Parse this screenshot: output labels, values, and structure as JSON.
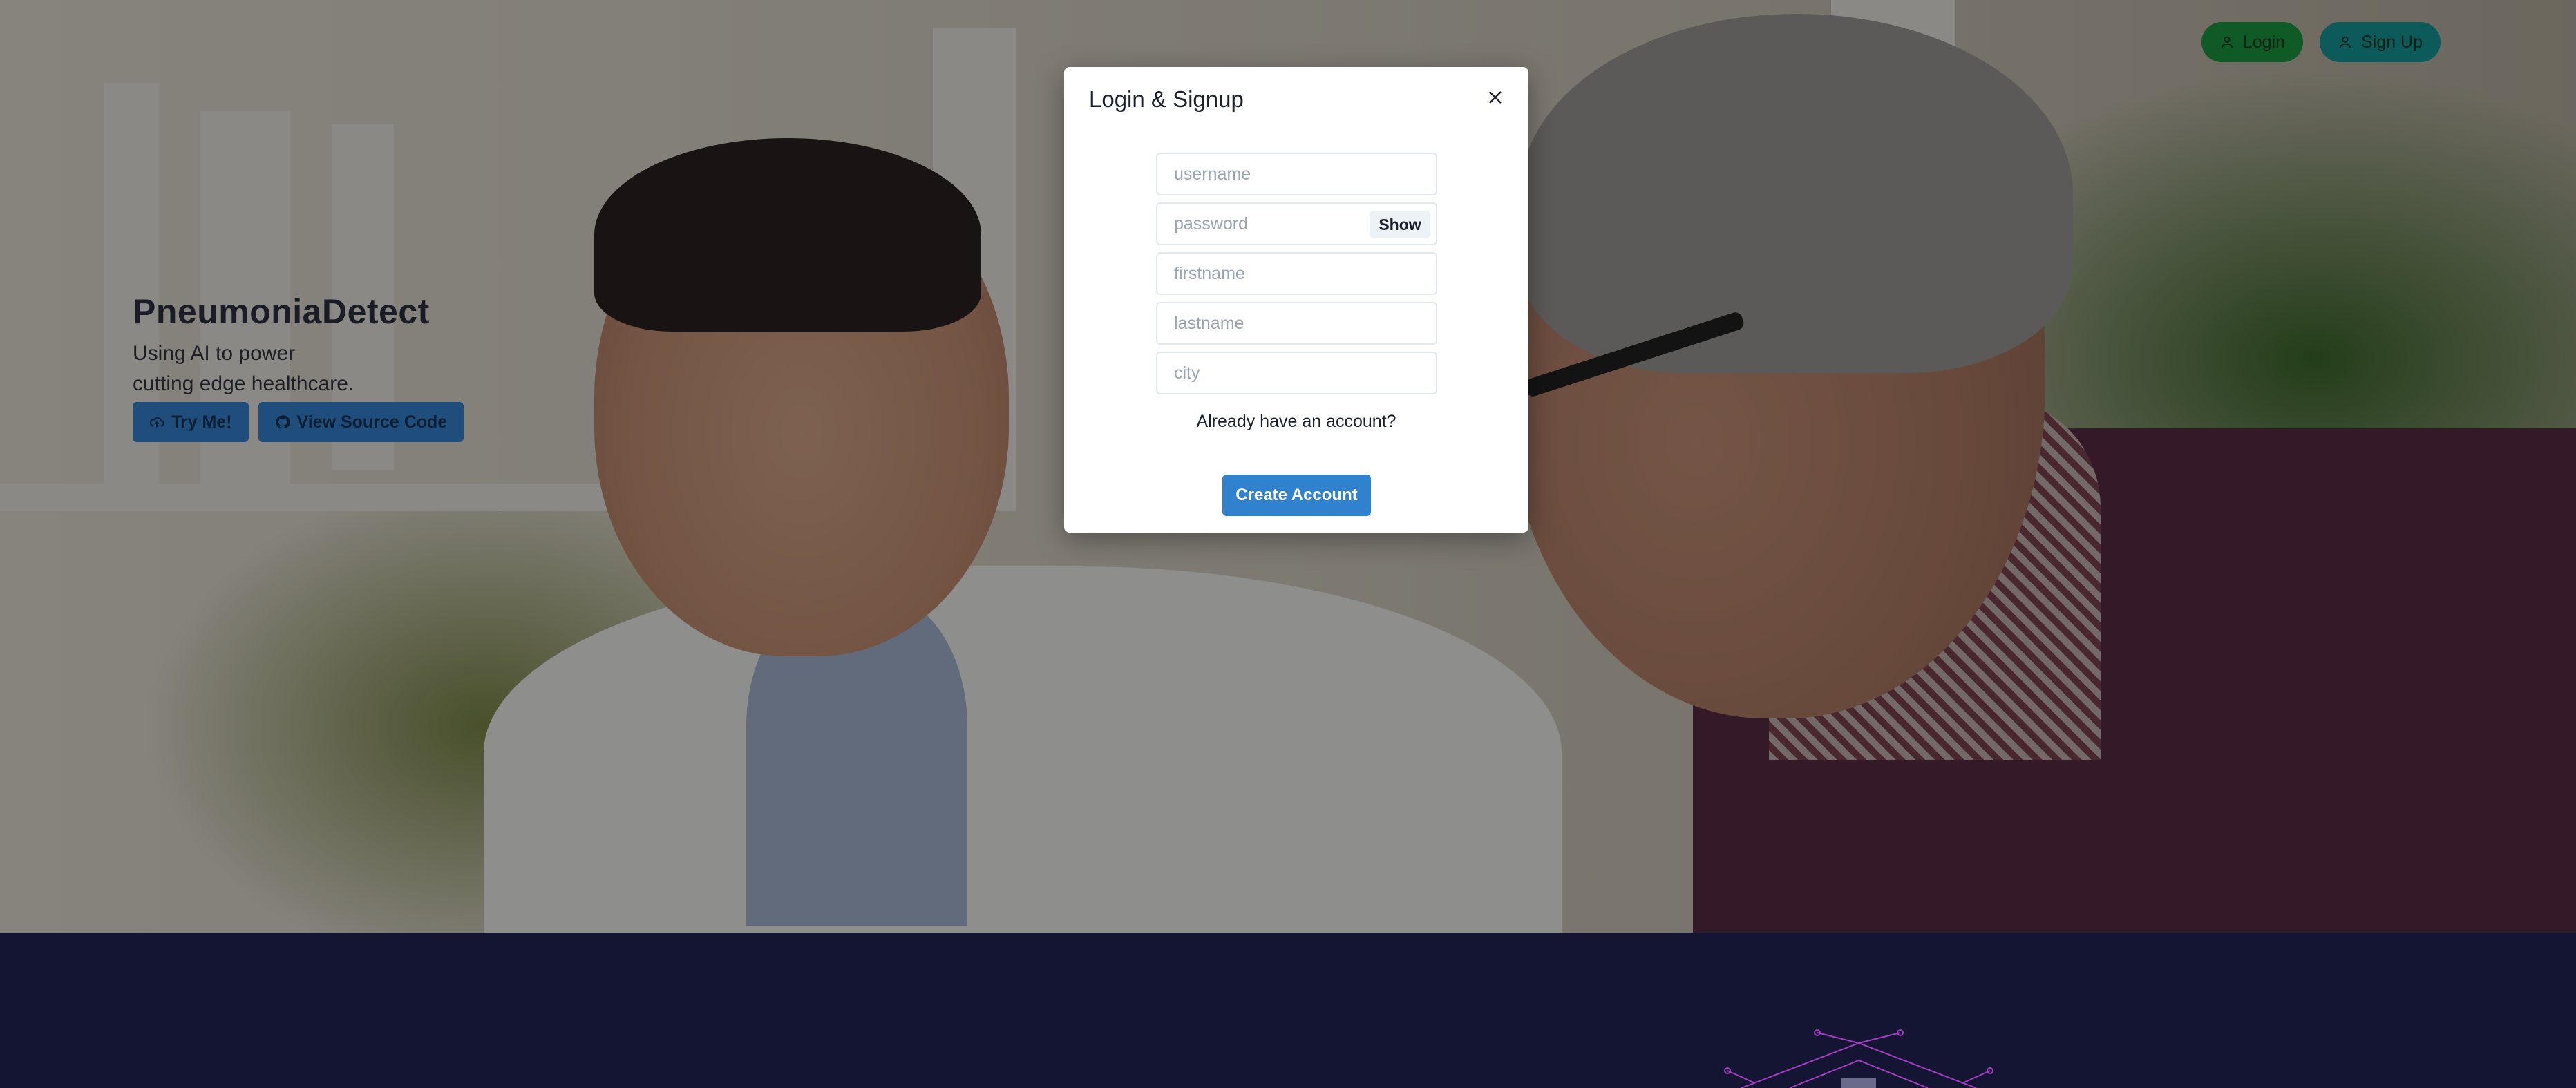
{
  "nav": {
    "login_label": "Login",
    "signup_label": "Sign Up"
  },
  "hero": {
    "title": "PneumoniaDetect",
    "subtitle_line1": "Using AI to power",
    "subtitle_line2": "cutting edge healthcare.",
    "try_label": "Try Me!",
    "source_label": "View Source Code"
  },
  "modal": {
    "title": "Login & Signup",
    "username_placeholder": "username",
    "password_placeholder": "password",
    "show_label": "Show",
    "firstname_placeholder": "firstname",
    "lastname_placeholder": "lastname",
    "city_placeholder": "city",
    "switch_text": "Already have an account?",
    "create_label": "Create Account"
  },
  "colors": {
    "primary_button": "#3182ce",
    "hero_button": "#1f4e7d",
    "login_nav": "#0f5a25",
    "signup_nav": "#0d5a5a",
    "dark_band": "#141433"
  }
}
